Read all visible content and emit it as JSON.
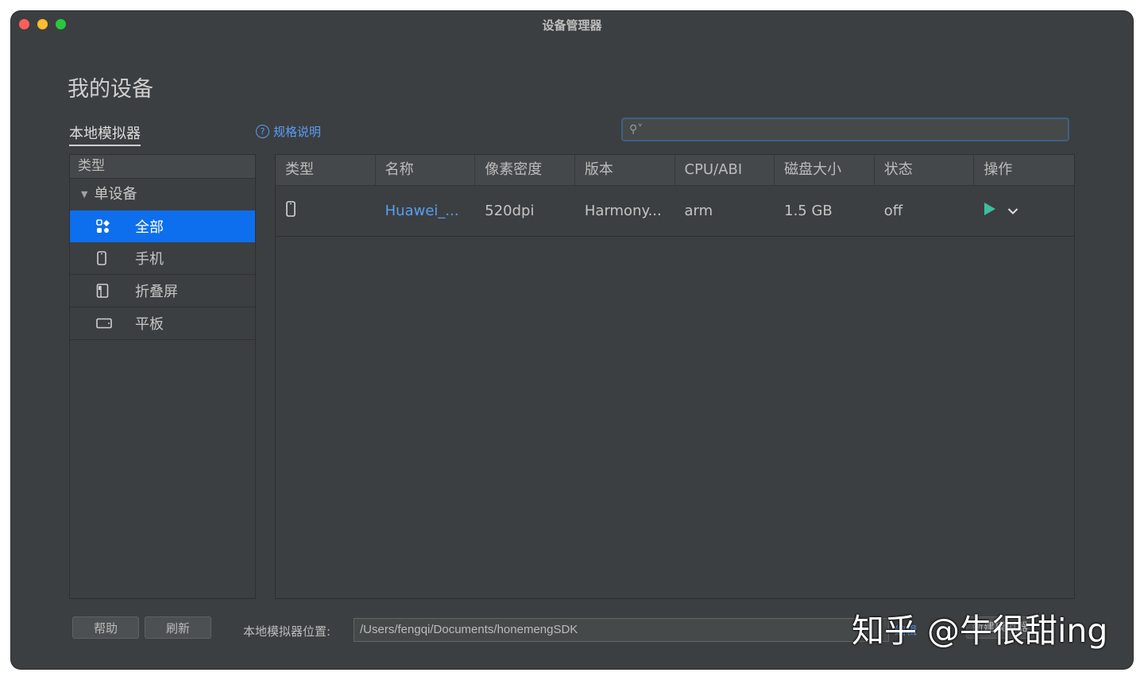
{
  "window": {
    "title": "设备管理器"
  },
  "page": {
    "heading": "我的设备"
  },
  "tabs": {
    "local_emulator": "本地模拟器"
  },
  "help_link": {
    "label": "规格说明"
  },
  "search": {
    "value": "",
    "placeholder": ""
  },
  "sidebar": {
    "header": "类型",
    "group": "单设备",
    "items": [
      {
        "label": "全部",
        "icon": "grid-icon",
        "selected": true
      },
      {
        "label": "手机",
        "icon": "phone-icon",
        "selected": false
      },
      {
        "label": "折叠屏",
        "icon": "foldable-icon",
        "selected": false
      },
      {
        "label": "平板",
        "icon": "tablet-icon",
        "selected": false
      }
    ]
  },
  "table": {
    "columns": [
      "类型",
      "名称",
      "像素密度",
      "版本",
      "CPU/ABI",
      "磁盘大小",
      "状态",
      "操作"
    ],
    "rows": [
      {
        "type_icon": "phone-icon",
        "name": "Huawei_...",
        "density": "520dpi",
        "version": "Harmony...",
        "cpu": "arm",
        "disk": "1.5 GB",
        "status": "off",
        "actions": [
          "play-icon",
          "chevron-down-icon"
        ]
      }
    ]
  },
  "footer": {
    "help_button": "帮助",
    "refresh_button": "刷新",
    "path_label": "本地模拟器位置:",
    "path_value": "/Users/fengqi/Documents/honemengSDK",
    "edit_link": "编辑",
    "new_button": "新建模拟器"
  },
  "watermark": "知乎 @牛很甜ing",
  "colors": {
    "accent": "#0d6fee",
    "link": "#589df6",
    "play": "#3dbfa0",
    "bg": "#3c3f41"
  }
}
